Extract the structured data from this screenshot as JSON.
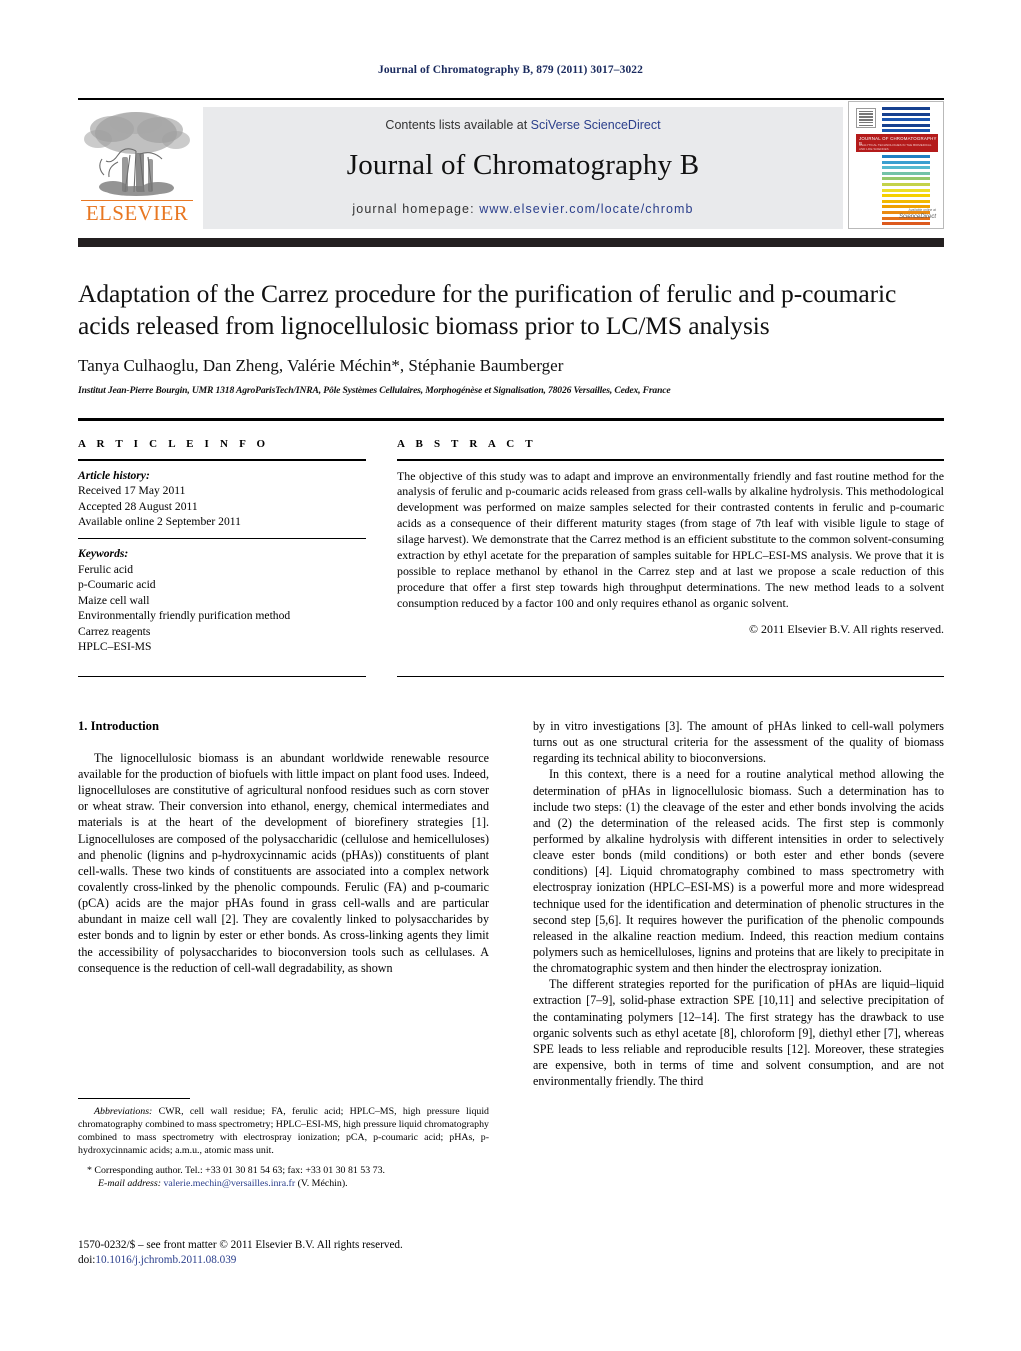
{
  "running_head": "Journal of Chromatography B, 879 (2011) 3017–3022",
  "masthead": {
    "contents_prefix": "Contents lists available at ",
    "contents_link": "SciVerse ScienceDirect",
    "journal_title": "Journal of Chromatography B",
    "homepage_prefix": "journal homepage: ",
    "homepage_url": "www.elsevier.com/locate/chromb",
    "publisher": "ELSEVIER",
    "cover": {
      "band_title": "JOURNAL OF CHROMATOGRAPHY B",
      "band_subtitle": "ANALYTICAL TECHNOLOGIES IN THE BIOMEDICAL AND LIFE SCIENCES",
      "footer_label": "Available online at",
      "footer_signature": "ScienceDirect"
    },
    "colors": {
      "link": "#2b3f8c",
      "elsevier_orange": "#E87722",
      "panel_gray": "#e9eaec",
      "rule_black": "#231f20",
      "cover_red": "#b41b1b"
    }
  },
  "article": {
    "title": "Adaptation of the Carrez procedure for the purification of ferulic and p-coumaric acids released from lignocellulosic biomass prior to LC/MS analysis",
    "authors": "Tanya Culhaoglu, Dan Zheng, Valérie Méchin*, Stéphanie Baumberger",
    "affiliation": "Institut Jean-Pierre Bourgin, UMR 1318 AgroParisTech/INRA, Pôle Systèmes Cellulaires, Morphogénèse et Signalisation, 78026 Versailles, Cedex, France"
  },
  "article_info": {
    "heading": "A R T I C L E   I N F O",
    "history_label": "Article history:",
    "history": [
      "Received 17 May 2011",
      "Accepted 28 August 2011",
      "Available online 2 September 2011"
    ],
    "keywords_label": "Keywords:",
    "keywords": [
      "Ferulic acid",
      "p-Coumaric acid",
      "Maize cell wall",
      "Environmentally friendly purification method",
      "Carrez reagents",
      "HPLC–ESI-MS"
    ]
  },
  "abstract": {
    "heading": "A B S T R A C T",
    "text": "The objective of this study was to adapt and improve an environmentally friendly and fast routine method for the analysis of ferulic and p-coumaric acids released from grass cell-walls by alkaline hydrolysis. This methodological development was performed on maize samples selected for their contrasted contents in ferulic and p-coumaric acids as a consequence of their different maturity stages (from stage of 7th leaf with visible ligule to stage of silage harvest). We demonstrate that the Carrez method is an efficient substitute to the common solvent-consuming extraction by ethyl acetate for the preparation of samples suitable for HPLC–ESI-MS analysis. We prove that it is possible to replace methanol by ethanol in the Carrez step and at last we propose a scale reduction of this procedure that offer a first step towards high throughput determinations. The new method leads to a solvent consumption reduced by a factor 100 and only requires ethanol as organic solvent.",
    "copyright": "© 2011 Elsevier B.V. All rights reserved."
  },
  "body": {
    "section_heading": "1.  Introduction",
    "left_paragraph": "The lignocellulosic biomass is an abundant worldwide renewable resource available for the production of biofuels with little impact on plant food uses. Indeed, lignocelluloses are constitutive of agricultural nonfood residues such as corn stover or wheat straw. Their conversion into ethanol, energy, chemical intermediates and materials is at the heart of the development of biorefinery strategies [1]. Lignocelluloses are composed of the polysaccharidic (cellulose and hemicelluloses) and phenolic (lignins and p-hydroxycinnamic acids (pHAs)) constituents of plant cell-walls. These two kinds of constituents are associated into a complex network covalently cross-linked by the phenolic compounds. Ferulic (FA) and p-coumaric (pCA) acids are the major pHAs found in grass cell-walls and are particular abundant in maize cell wall [2]. They are covalently linked to polysaccharides by ester bonds and to lignin by ester or ether bonds. As cross-linking agents they limit the accessibility of polysaccharides to bioconversion tools such as cellulases. A consequence is the reduction of cell-wall degradability, as shown",
    "right_paragraph_1": "by in vitro investigations [3]. The amount of pHAs linked to cell-wall polymers turns out as one structural criteria for the assessment of the quality of biomass regarding its technical ability to bioconversions.",
    "right_paragraph_2": "In this context, there is a need for a routine analytical method allowing the determination of pHAs in lignocellulosic biomass. Such a determination has to include two steps: (1) the cleavage of the ester and ether bonds involving the acids and (2) the determination of the released acids. The first step is commonly performed by alkaline hydrolysis with different intensities in order to selectively cleave ester bonds (mild conditions) or both ester and ether bonds (severe conditions) [4]. Liquid chromatography combined to mass spectrometry with electrospray ionization (HPLC–ESI-MS) is a powerful more and more widespread technique used for the identification and determination of phenolic structures in the second step [5,6]. It requires however the purification of the phenolic compounds released in the alkaline reaction medium. Indeed, this reaction medium contains polymers such as hemicelluloses, lignins and proteins that are likely to precipitate in the chromatographic system and then hinder the electrospray ionization.",
    "right_paragraph_3": "The different strategies reported for the purification of pHAs are liquid–liquid extraction [7–9], solid-phase extraction SPE [10,11] and selective precipitation of the contaminating polymers [12–14]. The first strategy has the drawback to use organic solvents such as ethyl acetate [8], chloroform [9], diethyl ether [7], whereas SPE leads to less reliable and reproducible results [12]. Moreover, these strategies are expensive, both in terms of time and solvent consumption, and are not environmentally friendly. The third"
  },
  "footnotes": {
    "abbrev_label": "Abbreviations:",
    "abbrev_text": " CWR, cell wall residue; FA, ferulic acid; HPLC–MS, high pressure liquid chromatography combined to mass spectrometry; HPLC–ESI-MS, high pressure liquid chromatography combined to mass spectrometry with electrospray ionization; pCA, p-coumaric acid; pHAs, p-hydroxycinnamic acids; a.m.u., atomic mass unit.",
    "corresponding": "* Corresponding author. Tel.: +33 01 30 81 54 63; fax: +33 01 30 81 53 73.",
    "email_label": "E-mail address:",
    "email": "valerie.mechin@versailles.inra.fr",
    "email_suffix": " (V. Méchin)."
  },
  "imprint": {
    "issn_line": "1570-0232/$ – see front matter © 2011 Elsevier B.V. All rights reserved.",
    "doi_label": "doi:",
    "doi": "10.1016/j.jchromb.2011.08.039"
  }
}
